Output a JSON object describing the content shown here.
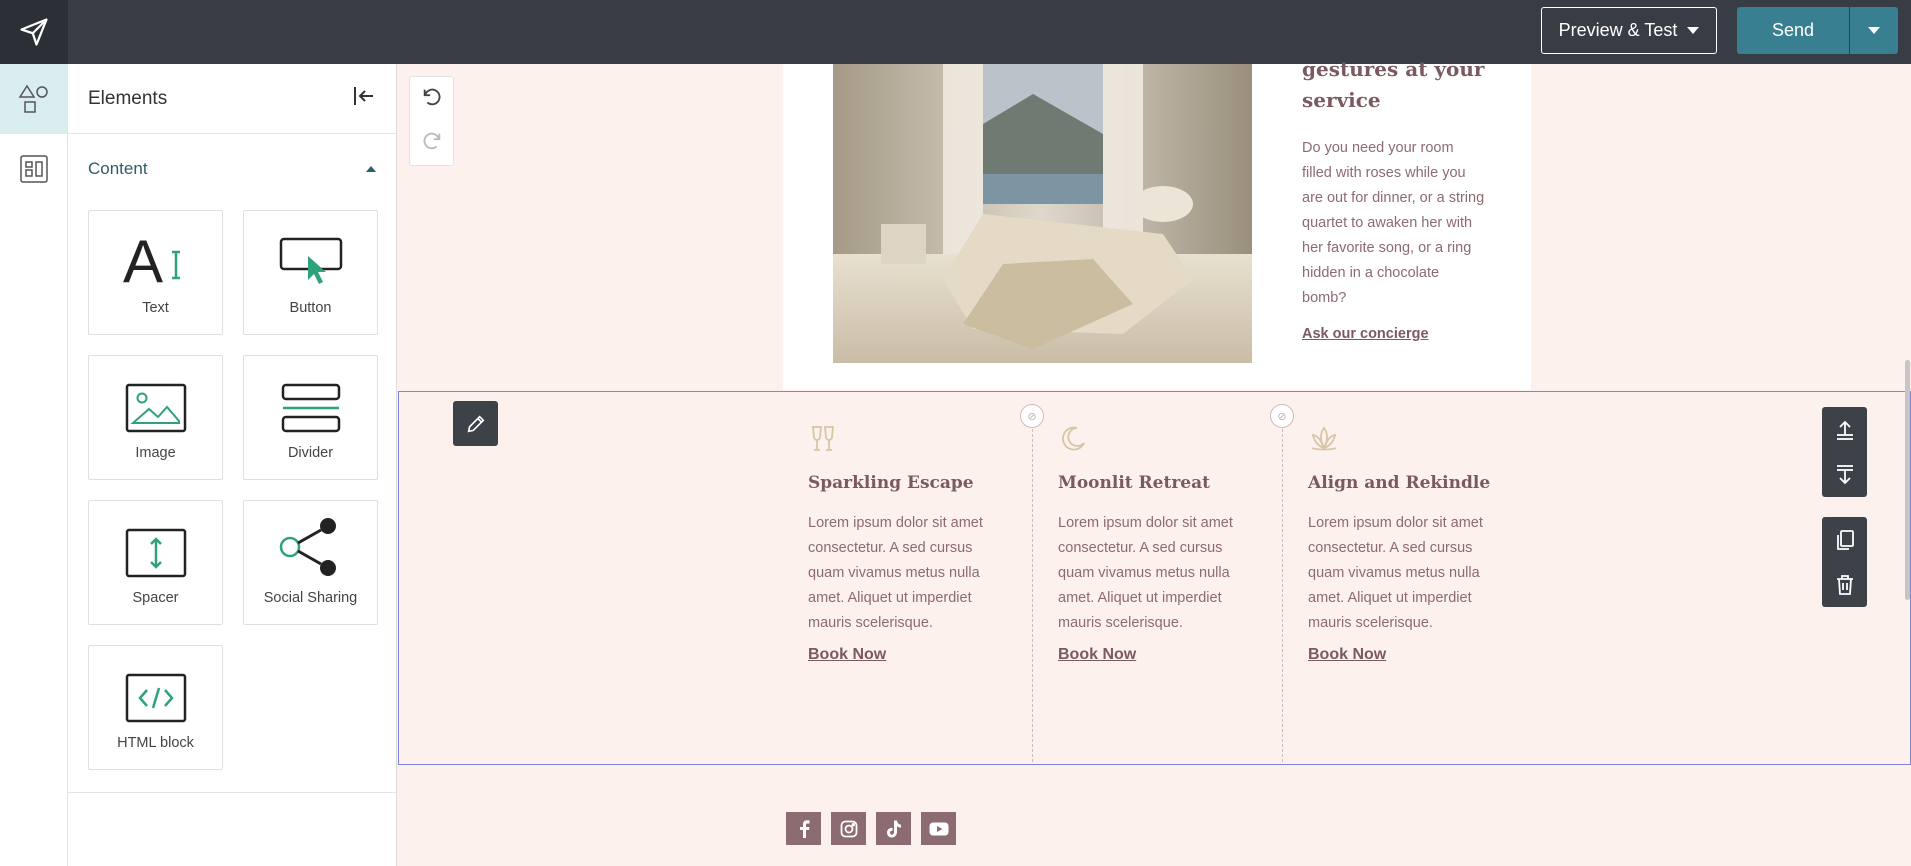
{
  "topbar": {
    "logo_icon": "paper-plane-icon",
    "preview_label": "Preview & Test",
    "send_label": "Send",
    "accent_color": "#397f92"
  },
  "rail": {
    "items": [
      {
        "icon": "shapes-icon",
        "active": true
      },
      {
        "icon": "layout-icon",
        "active": false
      }
    ]
  },
  "panel": {
    "title": "Elements",
    "collapse_icon": "collapse-left-icon",
    "section_title": "Content",
    "tiles": [
      {
        "label": "Text",
        "icon": "text-icon"
      },
      {
        "label": "Button",
        "icon": "button-icon"
      },
      {
        "label": "Image",
        "icon": "image-icon"
      },
      {
        "label": "Divider",
        "icon": "divider-icon"
      },
      {
        "label": "Spacer",
        "icon": "spacer-icon"
      },
      {
        "label": "Social Sharing",
        "icon": "share-icon"
      },
      {
        "label": "HTML block",
        "icon": "code-icon"
      }
    ]
  },
  "canvas": {
    "hero": {
      "heading": "gestures at your service",
      "body": "Do you need your room filled with roses while you are out for dinner, or a string quartet to awaken her with her favorite song, or a ring hidden in a chocolate bomb?",
      "link": "Ask our concierge"
    },
    "columns": [
      {
        "icon": "champagne-icon",
        "title": "Sparkling Escape",
        "text": "Lorem ipsum dolor sit amet consectetur. A sed cursus quam vivamus metus nulla amet. Aliquet ut imperdiet mauris scelerisque.",
        "link": "Book Now"
      },
      {
        "icon": "moon-icon",
        "title": "Moonlit Retreat",
        "text": "Lorem ipsum dolor sit amet consectetur. A sed cursus quam vivamus metus nulla amet. Aliquet ut imperdiet mauris scelerisque.",
        "link": "Book Now"
      },
      {
        "icon": "lotus-icon",
        "title": "Align and Rekindle",
        "text": "Lorem ipsum dolor sit amet consectetur. A sed cursus quam vivamus metus nulla amet. Aliquet ut imperdiet mauris scelerisque.",
        "link": "Book Now"
      }
    ],
    "socials": [
      "facebook-icon",
      "instagram-icon",
      "tiktok-icon",
      "youtube-icon"
    ]
  }
}
